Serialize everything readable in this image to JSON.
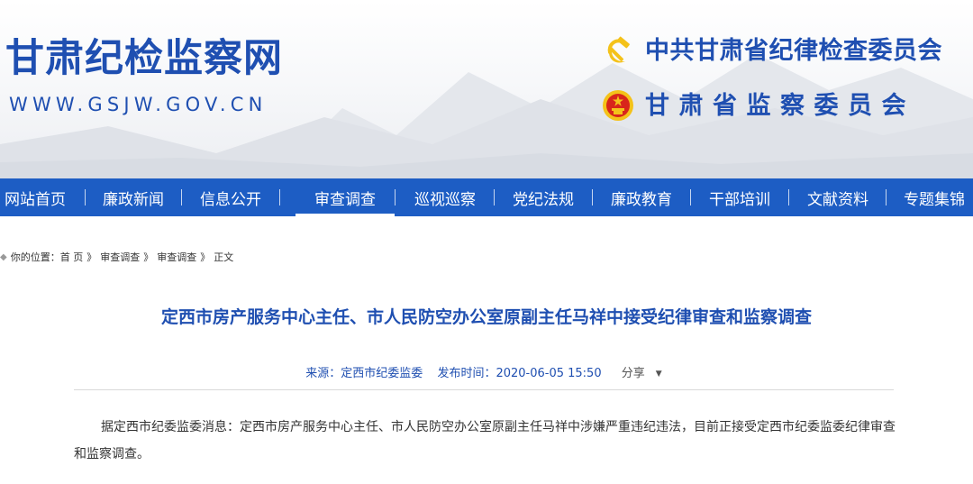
{
  "header": {
    "site_title": "甘肃纪检监察网",
    "site_url": "WWW.GSJW.GOV.CN",
    "org_line1": "中共甘肃省纪律检查委员会",
    "org_line2": "甘肃省监察委员会"
  },
  "nav": {
    "items": [
      {
        "label": "网站首页"
      },
      {
        "label": "廉政新闻"
      },
      {
        "label": "信息公开"
      },
      {
        "label": "审查调查"
      },
      {
        "label": "巡视巡察"
      },
      {
        "label": "党纪法规"
      },
      {
        "label": "廉政教育"
      },
      {
        "label": "干部培训"
      },
      {
        "label": "文献资料"
      },
      {
        "label": "专题集锦"
      }
    ],
    "active_index": 3
  },
  "breadcrumb": {
    "prefix": "你的位置：",
    "items": [
      "首 页",
      "审查调查",
      "审查调查"
    ],
    "separator": "》",
    "current": "正文"
  },
  "article": {
    "title": "定西市房产服务中心主任、市人民防空办公室原副主任马祥中接受纪律审查和监察调查",
    "source": "来源：定西市纪委监委",
    "published": "发布时间：2020-06-05 15:50",
    "share_label": "分享",
    "body": "据定西市纪委监委消息：定西市房产服务中心主任、市人民防空办公室原副主任马祥中涉嫌严重违纪违法，目前正接受定西市纪委监委纪律审查和监察调查。"
  },
  "colors": {
    "brand_blue": "#1f4fb1",
    "nav_blue": "#1d5dc4",
    "emblem_red": "#d8261b",
    "emblem_gold": "#f4c21a"
  },
  "icons": {
    "party_emblem": "hammer-and-sickle-icon",
    "national_emblem": "national-emblem-icon",
    "location": "location-icon",
    "share_caret": "caret-down-icon"
  }
}
